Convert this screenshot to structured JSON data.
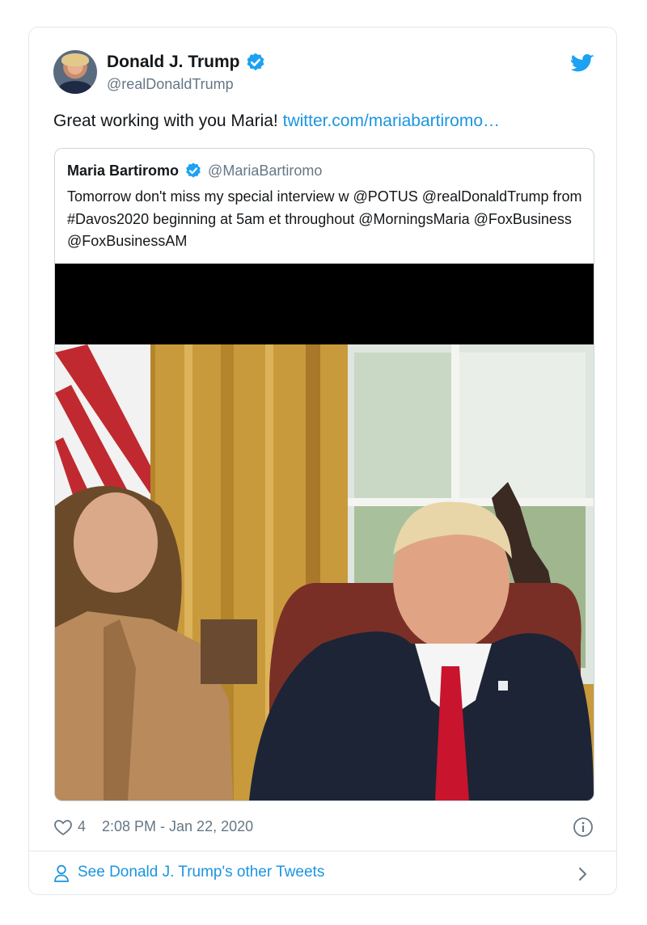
{
  "tweet": {
    "author_name": "Donald J. Trump",
    "author_handle": "@realDonaldTrump",
    "text_prefix": "Great working with you Maria! ",
    "link_text": "twitter.com/mariabartiromo…",
    "likes": "4",
    "timestamp": "2:08 PM - Jan 22, 2020",
    "more_label": "See Donald J. Trump's other Tweets"
  },
  "quoted": {
    "author_name": "Maria Bartiromo",
    "author_handle": "@MariaBartiromo",
    "text": "Tomorrow don't miss my special interview w  @POTUS  @realDonaldTrump from  #Davos2020 beginning  at 5am et throughout  @MorningsMaria   @FoxBusiness   @FoxBusinessAM"
  },
  "icons": {
    "verified": "verified-badge-icon",
    "bird": "twitter-bird-icon",
    "heart": "heart-icon",
    "info": "info-icon",
    "person": "person-icon",
    "chevron": "chevron-right-icon"
  },
  "colors": {
    "link": "#1b95e0",
    "muted": "#657786",
    "border": "#e1e8ed",
    "verified": "#1da1f2"
  }
}
